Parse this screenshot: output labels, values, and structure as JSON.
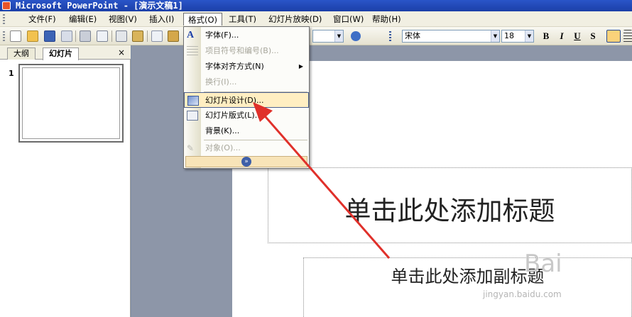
{
  "window": {
    "title": "Microsoft PowerPoint - [演示文稿1]"
  },
  "menubar": {
    "items": [
      {
        "label": "文件(F)"
      },
      {
        "label": "编辑(E)"
      },
      {
        "label": "视图(V)"
      },
      {
        "label": "插入(I)"
      },
      {
        "label": "格式(O)"
      },
      {
        "label": "工具(T)"
      },
      {
        "label": "幻灯片放映(D)"
      },
      {
        "label": "窗口(W)"
      },
      {
        "label": "帮助(H)"
      }
    ]
  },
  "toolbar": {
    "font_name": "宋体",
    "font_size": "18",
    "bold_label": "B",
    "italic_label": "I",
    "underline_label": "U",
    "shadow_label": "S"
  },
  "format_menu": {
    "items": [
      {
        "label": "字体(F)...",
        "icon": "font-A-icon",
        "disabled": false
      },
      {
        "label": "项目符号和编号(B)...",
        "icon": "bullets-icon",
        "disabled": true
      },
      {
        "label": "字体对齐方式(N)",
        "icon": "",
        "disabled": false,
        "submenu": true
      },
      {
        "label": "换行(I)...",
        "icon": "",
        "disabled": true
      },
      {
        "label": "幻灯片设计(D)...",
        "icon": "slide-design-icon",
        "disabled": false,
        "highlighted": true
      },
      {
        "label": "幻灯片版式(L)...",
        "icon": "slide-layout-icon",
        "disabled": false
      },
      {
        "label": "背景(K)...",
        "icon": "",
        "disabled": false
      },
      {
        "label": "对象(O)...",
        "icon": "object-icon",
        "disabled": true
      }
    ],
    "expand_glyph": "»"
  },
  "left_pane": {
    "tabs": [
      {
        "label": "大纲"
      },
      {
        "label": "幻灯片"
      }
    ],
    "close_glyph": "×",
    "slide_number": "1"
  },
  "slide": {
    "title_placeholder": "单击此处添加标题",
    "subtitle_placeholder": "单击此处添加副标题"
  },
  "watermark": {
    "text": "jingyan.baidu.com",
    "logo": "Bai"
  },
  "colors": {
    "titlebar": "#1b3fa8",
    "menu_highlight": "#ffeec2",
    "annotation_arrow": "#e0302a"
  }
}
